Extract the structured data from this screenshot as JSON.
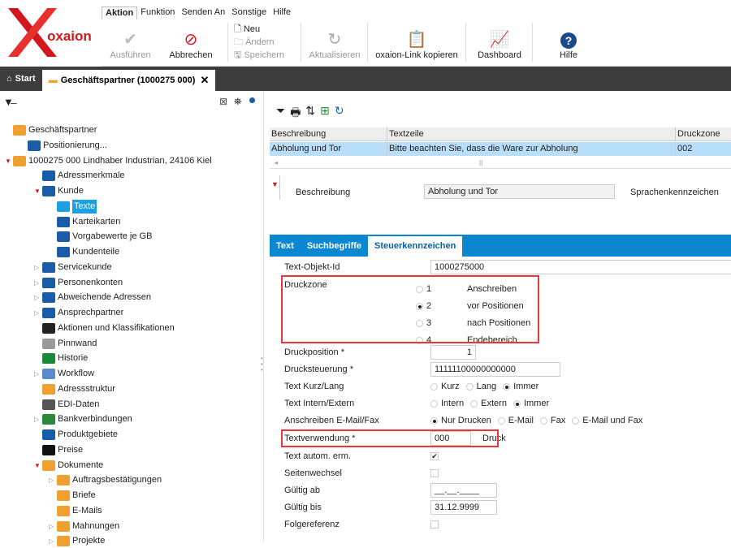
{
  "app": {
    "logo_text": "oxaion"
  },
  "menu": [
    "Aktion",
    "Funktion",
    "Senden An",
    "Sonstige",
    "Hilfe"
  ],
  "ribbon": {
    "execute": "Ausführen",
    "cancel": "Abbrechen",
    "new": "Neu",
    "change": "Ändern",
    "save": "Speichern",
    "refresh": "Aktualisieren",
    "copy_link": "oxaion-Link kopieren",
    "dashboard": "Dashboard",
    "help": "Hilfe"
  },
  "tabs": {
    "start": "Start",
    "partner": "Geschäftspartner (1000275 000)"
  },
  "tree": [
    {
      "label": "Geschäftspartner",
      "indent": 0,
      "arrow": ""
    },
    {
      "label": "Positionierung...",
      "indent": 1,
      "arrow": ""
    },
    {
      "label": "1000275  000  Lindhaber Industrian, 24106 Kiel",
      "indent": 0,
      "arrow": "▼"
    },
    {
      "label": "Adressmerkmale",
      "indent": 2,
      "arrow": ""
    },
    {
      "label": "Kunde",
      "indent": 2,
      "arrow": "▼"
    },
    {
      "label": "Texte",
      "indent": 3,
      "arrow": "",
      "sel": true
    },
    {
      "label": "Karteikarten",
      "indent": 3,
      "arrow": ""
    },
    {
      "label": "Vorgabewerte je GB",
      "indent": 3,
      "arrow": ""
    },
    {
      "label": "Kundenteile",
      "indent": 3,
      "arrow": ""
    },
    {
      "label": "Servicekunde",
      "indent": 2,
      "arrow": "▷"
    },
    {
      "label": "Personenkonten",
      "indent": 2,
      "arrow": "▷"
    },
    {
      "label": "Abweichende Adressen",
      "indent": 2,
      "arrow": "▷"
    },
    {
      "label": "Ansprechpartner",
      "indent": 2,
      "arrow": "▷"
    },
    {
      "label": "Aktionen und Klassifikationen",
      "indent": 2,
      "arrow": ""
    },
    {
      "label": "Pinnwand",
      "indent": 2,
      "arrow": ""
    },
    {
      "label": "Historie",
      "indent": 2,
      "arrow": ""
    },
    {
      "label": "Workflow",
      "indent": 2,
      "arrow": "▷"
    },
    {
      "label": "Adressstruktur",
      "indent": 2,
      "arrow": ""
    },
    {
      "label": "EDI-Daten",
      "indent": 2,
      "arrow": ""
    },
    {
      "label": "Bankverbindungen",
      "indent": 2,
      "arrow": "▷"
    },
    {
      "label": "Produktgebiete",
      "indent": 2,
      "arrow": ""
    },
    {
      "label": "Preise",
      "indent": 2,
      "arrow": ""
    },
    {
      "label": "Dokumente",
      "indent": 2,
      "arrow": "▼"
    },
    {
      "label": "Auftragsbestätigungen",
      "indent": 3,
      "arrow": "▷"
    },
    {
      "label": "Briefe",
      "indent": 3,
      "arrow": ""
    },
    {
      "label": "E-Mails",
      "indent": 3,
      "arrow": ""
    },
    {
      "label": "Mahnungen",
      "indent": 3,
      "arrow": "▷"
    },
    {
      "label": "Projekte",
      "indent": 3,
      "arrow": "▷"
    }
  ],
  "grid": {
    "headers": [
      "Beschreibung",
      "Textzeile",
      "Druckzone"
    ],
    "row": [
      "Abholung und Tor",
      "Bitte beachten Sie, dass die Ware zur Abholung",
      "002"
    ]
  },
  "detail": {
    "label": "Beschreibung",
    "value": "Abholung und Tor",
    "lang_label": "Sprachenkennzeichen"
  },
  "subtabs": [
    "Text",
    "Suchbegriffe",
    "Steuerkennzeichen"
  ],
  "form": {
    "obj_id_label": "Text-Objekt-Id",
    "obj_id": "1000275000",
    "druckzone_label": "Druckzone",
    "zones": [
      {
        "num": "1",
        "text": "Anschreiben",
        "on": false
      },
      {
        "num": "2",
        "text": "vor Positionen",
        "on": true
      },
      {
        "num": "3",
        "text": "nach Positionen",
        "on": false
      },
      {
        "num": "4",
        "text": "Endebereich",
        "on": false
      }
    ],
    "druckpos_label": "Druckposition *",
    "druckpos": "1",
    "drucksteu_label": "Drucksteuerung *",
    "drucksteu": "11111100000000000",
    "kurzlang_label": "Text Kurz/Lang",
    "kurzlang": [
      "Kurz",
      "Lang",
      "Immer"
    ],
    "intern_label": "Text Intern/Extern",
    "intern": [
      "Intern",
      "Extern",
      "Immer"
    ],
    "mail_label": "Anschreiben E-Mail/Fax",
    "mail": [
      "Nur Drucken",
      "E-Mail",
      "Fax",
      "E-Mail und Fax"
    ],
    "verw_label": "Textverwendung *",
    "verw": "000",
    "verw_text": "Druck",
    "autom_label": "Text autom. erm.",
    "seiten_label": "Seitenwechsel",
    "gab_label": "Gültig ab",
    "gab": "__.__.____",
    "gbis_label": "Gültig bis",
    "gbis": "31.12.9999",
    "folge_label": "Folgereferenz"
  }
}
